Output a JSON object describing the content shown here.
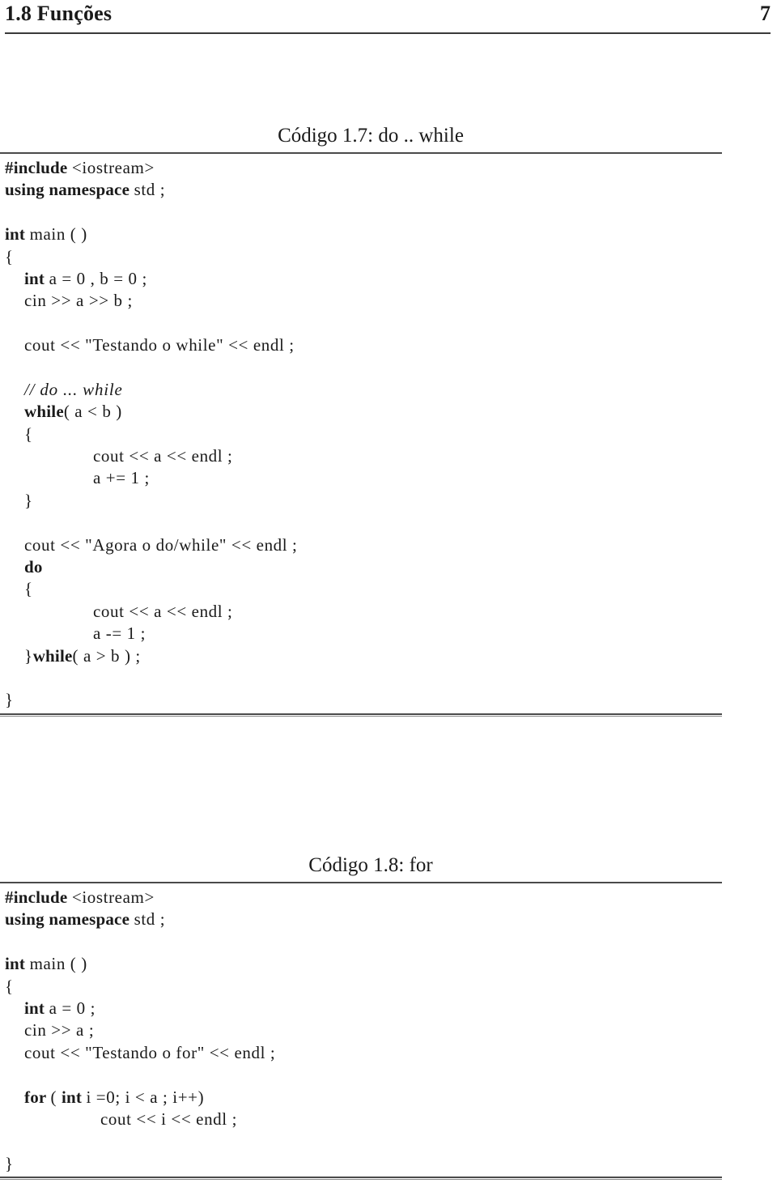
{
  "page": {
    "header_title": "1.8 Funções",
    "page_number": "7"
  },
  "listings": [
    {
      "id": "listing-1",
      "caption": "Código 1.7: do .. while",
      "lines": [
        {
          "indent": 0,
          "tokens": [
            {
              "t": "#include ",
              "s": "kw"
            },
            {
              "t": "<iostream>",
              "s": "plain"
            }
          ]
        },
        {
          "indent": 0,
          "tokens": [
            {
              "t": "using namespace ",
              "s": "kw"
            },
            {
              "t": "std ;",
              "s": "plain"
            }
          ]
        },
        {
          "indent": 0,
          "tokens": []
        },
        {
          "indent": 0,
          "tokens": [
            {
              "t": "int ",
              "s": "kw"
            },
            {
              "t": "main ( )",
              "s": "plain"
            }
          ]
        },
        {
          "indent": 0,
          "tokens": [
            {
              "t": "{",
              "s": "plain"
            }
          ]
        },
        {
          "indent": 1,
          "tokens": [
            {
              "t": "int ",
              "s": "kw"
            },
            {
              "t": "a = 0 , b = 0 ;",
              "s": "plain"
            }
          ]
        },
        {
          "indent": 1,
          "tokens": [
            {
              "t": "cin >> a >> b ;",
              "s": "plain"
            }
          ]
        },
        {
          "indent": 0,
          "tokens": []
        },
        {
          "indent": 1,
          "tokens": [
            {
              "t": "cout << \"Testando o while\" << endl ;",
              "s": "plain"
            }
          ]
        },
        {
          "indent": 0,
          "tokens": []
        },
        {
          "indent": 1,
          "tokens": [
            {
              "t": "// do ... while",
              "s": "cmt"
            }
          ]
        },
        {
          "indent": 1,
          "tokens": [
            {
              "t": "while",
              "s": "kw"
            },
            {
              "t": "( a < b )",
              "s": "plain"
            }
          ]
        },
        {
          "indent": 1,
          "tokens": [
            {
              "t": "{",
              "s": "plain"
            }
          ]
        },
        {
          "indent": 2,
          "tokens": [
            {
              "t": "cout << a << endl ;",
              "s": "plain"
            }
          ]
        },
        {
          "indent": 2,
          "tokens": [
            {
              "t": "a += 1 ;",
              "s": "plain"
            }
          ]
        },
        {
          "indent": 1,
          "tokens": [
            {
              "t": "}",
              "s": "plain"
            }
          ]
        },
        {
          "indent": 0,
          "tokens": []
        },
        {
          "indent": 1,
          "tokens": [
            {
              "t": "cout << \"Agora o do/while\" << endl ;",
              "s": "plain"
            }
          ]
        },
        {
          "indent": 1,
          "tokens": [
            {
              "t": "do",
              "s": "kw"
            }
          ]
        },
        {
          "indent": 1,
          "tokens": [
            {
              "t": "{",
              "s": "plain"
            }
          ]
        },
        {
          "indent": 2,
          "tokens": [
            {
              "t": "cout << a << endl ;",
              "s": "plain"
            }
          ]
        },
        {
          "indent": 2,
          "tokens": [
            {
              "t": "a -= 1 ;",
              "s": "plain"
            }
          ]
        },
        {
          "indent": 1,
          "tokens": [
            {
              "t": "}",
              "s": "plain"
            },
            {
              "t": "while",
              "s": "kw"
            },
            {
              "t": "( a > b ) ;",
              "s": "plain"
            }
          ]
        },
        {
          "indent": 0,
          "tokens": []
        },
        {
          "indent": 0,
          "tokens": [
            {
              "t": "}",
              "s": "plain"
            }
          ]
        }
      ]
    },
    {
      "id": "listing-2",
      "caption": "Código 1.8: for",
      "lines": [
        {
          "indent": 0,
          "tokens": [
            {
              "t": "#include ",
              "s": "kw"
            },
            {
              "t": "<iostream>",
              "s": "plain"
            }
          ]
        },
        {
          "indent": 0,
          "tokens": [
            {
              "t": "using namespace ",
              "s": "kw"
            },
            {
              "t": "std ;",
              "s": "plain"
            }
          ]
        },
        {
          "indent": 0,
          "tokens": []
        },
        {
          "indent": 0,
          "tokens": [
            {
              "t": "int ",
              "s": "kw"
            },
            {
              "t": "main ( )",
              "s": "plain"
            }
          ]
        },
        {
          "indent": 0,
          "tokens": [
            {
              "t": "{",
              "s": "plain"
            }
          ]
        },
        {
          "indent": 1,
          "tokens": [
            {
              "t": "int ",
              "s": "kw"
            },
            {
              "t": "a = 0 ;",
              "s": "plain"
            }
          ]
        },
        {
          "indent": 1,
          "tokens": [
            {
              "t": "cin >> a ;",
              "s": "plain"
            }
          ]
        },
        {
          "indent": 1,
          "tokens": [
            {
              "t": "cout << \"Testando o for\" << endl ;",
              "s": "plain"
            }
          ]
        },
        {
          "indent": 0,
          "tokens": []
        },
        {
          "indent": 1,
          "tokens": [
            {
              "t": "for ",
              "s": "kw"
            },
            {
              "t": "( ",
              "s": "plain"
            },
            {
              "t": "int ",
              "s": "kw"
            },
            {
              "t": "i =0; i < a ; i++)",
              "s": "plain"
            }
          ]
        },
        {
          "indent": 3,
          "tokens": [
            {
              "t": "cout << i << endl ;",
              "s": "plain"
            }
          ]
        },
        {
          "indent": 0,
          "tokens": []
        },
        {
          "indent": 0,
          "tokens": [
            {
              "t": "}",
              "s": "plain"
            }
          ]
        }
      ]
    }
  ]
}
